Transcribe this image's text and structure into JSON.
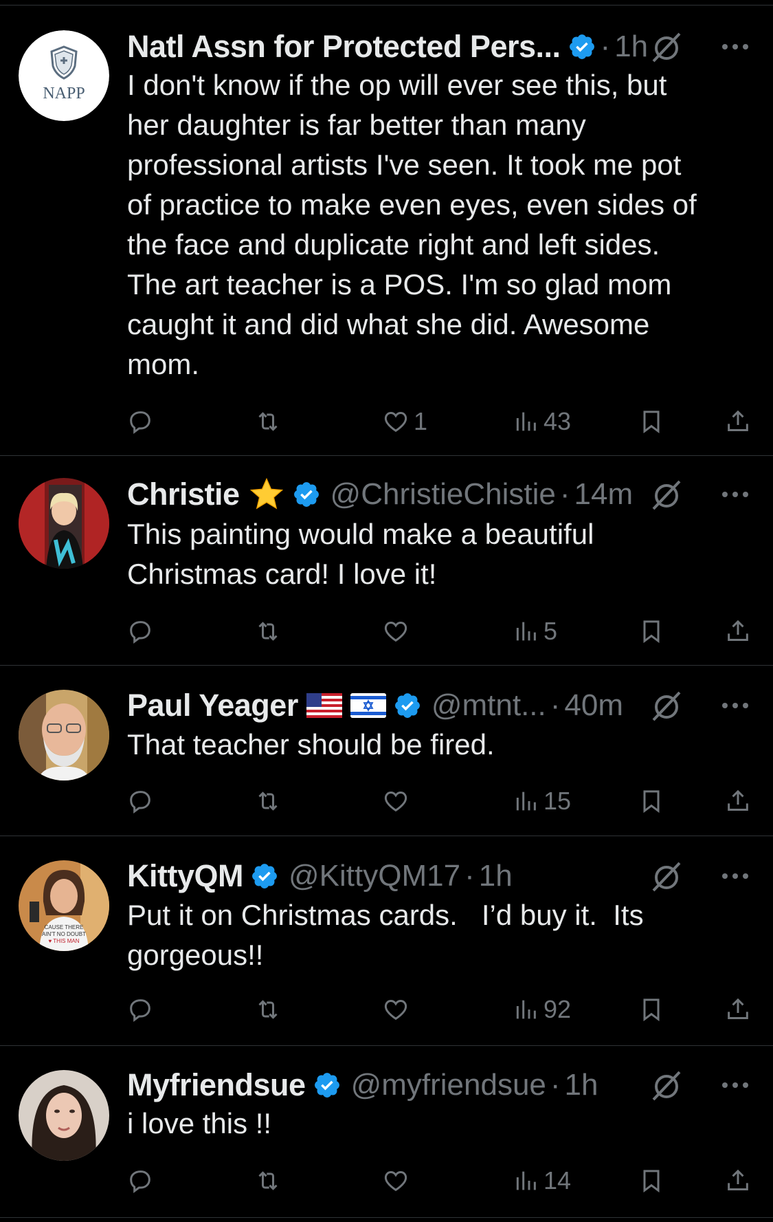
{
  "colors": {
    "background": "#000000",
    "text": "#e7e9ea",
    "muted": "#71767b",
    "verified": "#1d9bf0",
    "divider": "#2f3336"
  },
  "tweets": [
    {
      "name": "Natl Assn for Protected Pers...",
      "avatar_text": "NAPP",
      "handle": "",
      "dot": "·",
      "time": "1h",
      "emoji": "",
      "lines": [
        "I don't know if the op will ever see this, but",
        "her daughter is far better than many",
        "professional artists I've seen. It took me  pot",
        "of practice to make even eyes, even sides of",
        "the face and duplicate right and left sides.",
        "The art teacher is a POS. I'm so glad mom",
        "caught it and did what she did. Awesome",
        "mom."
      ],
      "likes": "1",
      "views": "43"
    },
    {
      "name": "Christie",
      "handle": "@ChristieChistie",
      "dot": "·",
      "time": "14m",
      "emoji": "star",
      "lines": [
        "This painting would make a beautiful",
        "Christmas card! I love it!"
      ],
      "likes": "",
      "views": "5"
    },
    {
      "name": "Paul Yeager",
      "handle": "@mtnt...",
      "dot": "·",
      "time": "40m",
      "emoji": "flags-us-il",
      "lines": [
        "That teacher should be fired."
      ],
      "likes": "",
      "views": "15"
    },
    {
      "name": "KittyQM",
      "handle": "@KittyQM17",
      "dot": "·",
      "time": "1h",
      "emoji": "",
      "lines": [
        "Put it on Christmas cards.   I’d buy it.  Its",
        "gorgeous!!"
      ],
      "likes": "",
      "views": "92"
    },
    {
      "name": "Myfriendsue",
      "handle": "@myfriendsue",
      "dot": "·",
      "time": "1h",
      "emoji": "",
      "lines": [
        "i love this !!"
      ],
      "likes": "",
      "views": "14"
    }
  ]
}
